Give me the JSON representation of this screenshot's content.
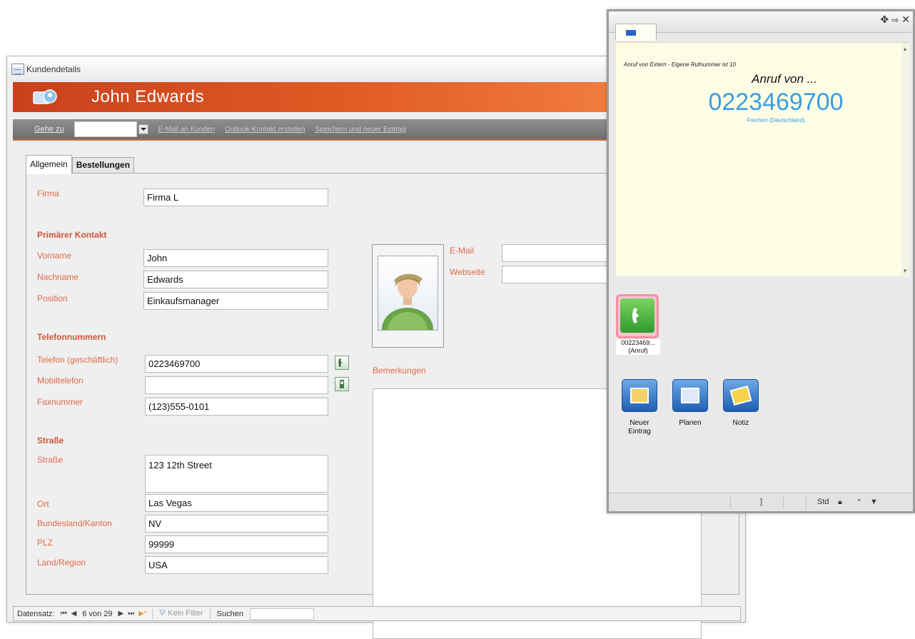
{
  "form": {
    "window_title": "Kundendetails",
    "header_name": "John Edwards",
    "toolbar": {
      "goto_label": "Gehe zu",
      "goto_value": "",
      "email_link": "E-Mail an Kunden",
      "outlook_link": "Outlook-Kontakt erstellen",
      "save_new_link": "Speichern und neuer Eintrag"
    },
    "tabs": [
      {
        "label": "Allgemein",
        "active": true
      },
      {
        "label": "Bestellungen",
        "active": false
      }
    ],
    "fields": {
      "firma": {
        "label": "Firma",
        "value": "Firma L"
      },
      "primary_contact_heading": "Primärer Kontakt",
      "vorname": {
        "label": "Vorname",
        "value": "John"
      },
      "nachname": {
        "label": "Nachname",
        "value": "Edwards"
      },
      "position": {
        "label": "Position",
        "value": "Einkaufsmanager"
      },
      "phone_heading": "Telefonnummern",
      "telefon": {
        "label": "Telefon (geschäftlich)",
        "value": "0223469700"
      },
      "mobil": {
        "label": "Mobiltelefon",
        "value": ""
      },
      "fax": {
        "label": "Faxnummer",
        "value": "(123)555-0101"
      },
      "street_heading": "Straße",
      "strasse": {
        "label": "Straße",
        "value": "123 12th Street"
      },
      "ort": {
        "label": "Ort",
        "value": "Las Vegas"
      },
      "bundesland": {
        "label": "Bundesland/Kanton",
        "value": "NV"
      },
      "plz": {
        "label": "PLZ",
        "value": "99999"
      },
      "land": {
        "label": "Land/Region",
        "value": "USA"
      },
      "email": {
        "label": "E-Mail",
        "value": ""
      },
      "webseite": {
        "label": "Webseite",
        "value": ""
      },
      "bemerkungen": {
        "label": "Bemerkungen",
        "value": ""
      }
    },
    "status_bar": {
      "record_label": "Datensatz:",
      "first": "⏮",
      "prev": "◀",
      "record_position": "6 von 29",
      "next": "▶",
      "last": "⏭",
      "new": "▶*",
      "filter": "Kein Filter",
      "search": "Suchen"
    }
  },
  "phone_popup": {
    "call_info": "Anruf von Extern - Eigene Rufnummer ist 10",
    "call_title": "Anruf von ...",
    "call_number": "0223469700",
    "call_location": "Frechen (Deutschland)",
    "active_call_label": "00223469... (Anruf)",
    "actions": [
      {
        "label": "Neuer Eintrag",
        "icon": "folder-icon"
      },
      {
        "label": "Planen",
        "icon": "calendar-icon"
      },
      {
        "label": "Notiz",
        "icon": "note-icon"
      }
    ],
    "status": {
      "hook": "]",
      "mode": "Std"
    },
    "controls": {
      "move": "✥",
      "close": "✕"
    }
  },
  "colors": {
    "header_orange": "#e05a24",
    "label_orange": "#e06a4a",
    "number_blue": "#3b9de0",
    "call_green": "#2f9b2c"
  }
}
